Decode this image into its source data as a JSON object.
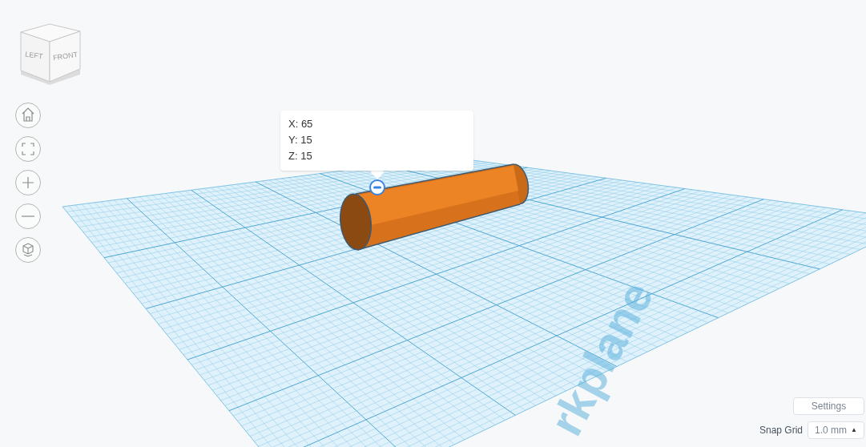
{
  "view_cube": {
    "left_label": "LEFT",
    "front_label": "FRONT"
  },
  "nav_buttons": [
    {
      "kind": "home"
    },
    {
      "kind": "fit"
    },
    {
      "kind": "zoom_in"
    },
    {
      "kind": "zoom_out"
    },
    {
      "kind": "perspective"
    }
  ],
  "tooltip": {
    "lines": [
      "X: 65",
      "Y: 15",
      "Z: 15"
    ]
  },
  "workplane": {
    "label": "rkplane"
  },
  "settings_button": "Settings",
  "snap_grid": {
    "label": "Snap Grid",
    "value": "1.0 mm",
    "caret": "▲"
  }
}
